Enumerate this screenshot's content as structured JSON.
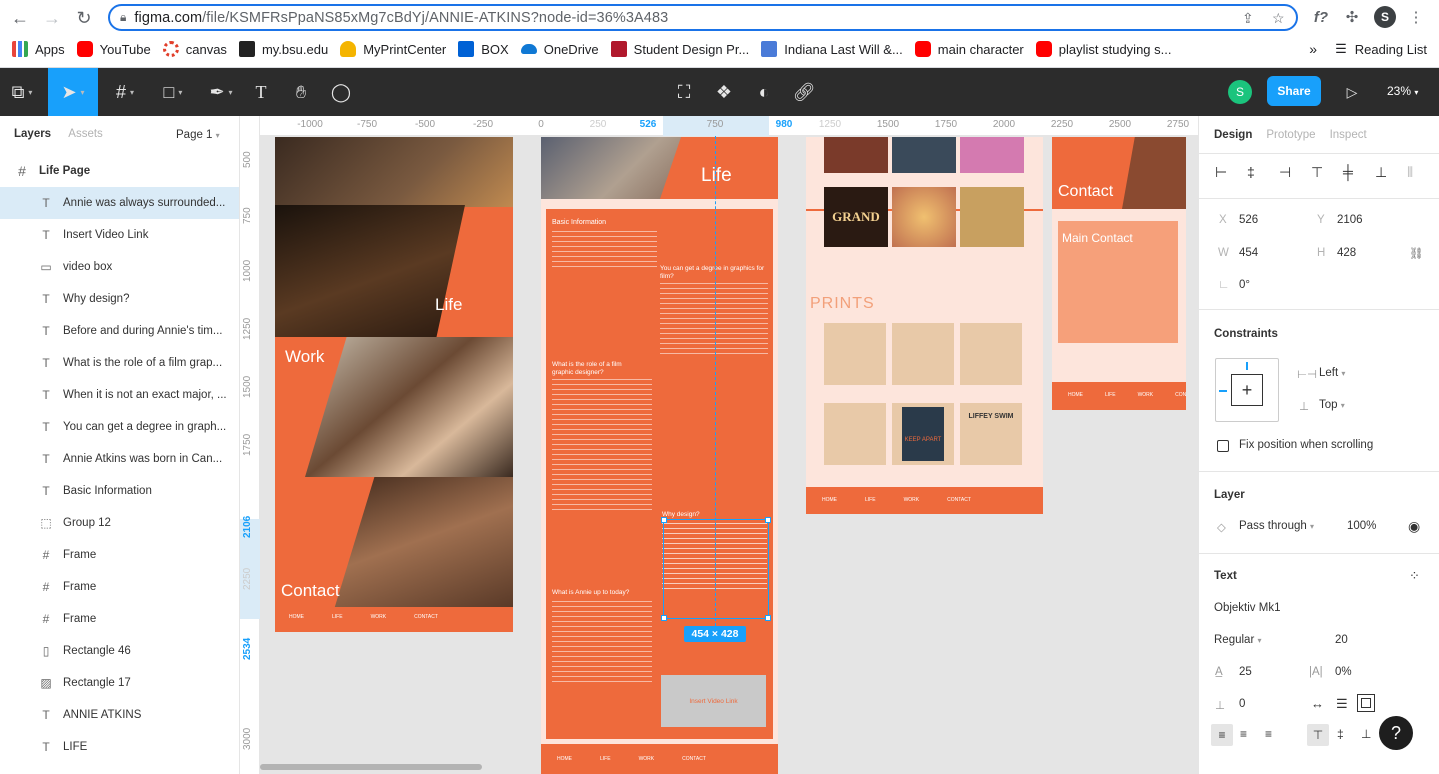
{
  "browser": {
    "url_host": "figma.com",
    "url_path": "/file/KSMFRsPpaNS85xMg7cBdYj/ANNIE-ATKINS?node-id=36%3A483",
    "profile_initial": "S",
    "bookmarks": [
      "Apps",
      "YouTube",
      "canvas",
      "my.bsu.edu",
      "MyPrintCenter",
      "BOX",
      "OneDrive",
      "Student Design Pr...",
      "Indiana Last Will &...",
      "main character",
      "playlist studying s..."
    ],
    "more": "»",
    "reading_list": "Reading List"
  },
  "toolbar": {
    "user_initial": "S",
    "share_label": "Share",
    "zoom": "23%"
  },
  "left_panel": {
    "tab_layers": "Layers",
    "tab_assets": "Assets",
    "page": "Page 1",
    "layers": [
      {
        "name": "Life Page",
        "type": "frame"
      },
      {
        "name": "Annie was always surrounded...",
        "type": "text"
      },
      {
        "name": "Insert Video Link",
        "type": "text"
      },
      {
        "name": "video box",
        "type": "rect"
      },
      {
        "name": "Why design?",
        "type": "text"
      },
      {
        "name": "Before and during Annie's tim...",
        "type": "text"
      },
      {
        "name": "What is the role of a film grap...",
        "type": "text"
      },
      {
        "name": "When it is not an exact major, ...",
        "type": "text"
      },
      {
        "name": "You can get a degree in graph...",
        "type": "text"
      },
      {
        "name": "Annie Atkins was born in Can...",
        "type": "text"
      },
      {
        "name": "Basic Information",
        "type": "text"
      },
      {
        "name": "Group 12",
        "type": "group"
      },
      {
        "name": "Frame",
        "type": "frame"
      },
      {
        "name": "Frame",
        "type": "frame"
      },
      {
        "name": "Frame",
        "type": "frame"
      },
      {
        "name": "Rectangle 46",
        "type": "line"
      },
      {
        "name": "Rectangle 17",
        "type": "image"
      },
      {
        "name": "ANNIE ATKINS",
        "type": "text"
      },
      {
        "name": "LIFE",
        "type": "text"
      }
    ]
  },
  "ruler": {
    "ticks": [
      "-1000",
      "-750",
      "-500",
      "-250",
      "0",
      "250",
      "526",
      "750",
      "980",
      "1250",
      "1500",
      "1750",
      "2000",
      "2250",
      "2500",
      "2750"
    ],
    "vticks": [
      "500",
      "750",
      "1000",
      "1250",
      "1500",
      "1750",
      "2106",
      "2250",
      "2534",
      "3000"
    ]
  },
  "canvas": {
    "frame1": {
      "life": "Life",
      "work": "Work",
      "contact": "Contact",
      "nav": [
        "HOME",
        "LIFE",
        "WORK",
        "CONTACT"
      ]
    },
    "frame2": {
      "life": "Life",
      "basic_info": "Basic Information",
      "degree": "You can get a degree in graphics for film?",
      "role": "What is the role of a film graphic designer?",
      "why": "Why design?",
      "up_to": "What is Annie up to today?",
      "video": "Insert Video Link",
      "nav": [
        "HOME",
        "LIFE",
        "WORK",
        "CONTACT"
      ]
    },
    "frame3": {
      "grand": "GRAND",
      "prints": "PRINTS",
      "keep_apart": "KEEP APART",
      "liffey": "LIFFEY SWIM",
      "nav": [
        "HOME",
        "LIFE",
        "WORK",
        "CONTACT"
      ]
    },
    "frame4": {
      "contact": "Contact",
      "main_contact": "Main Contact",
      "nav": [
        "HOME",
        "LIFE",
        "WORK",
        "CONTA"
      ]
    },
    "selection_size": "454 × 428"
  },
  "right_panel": {
    "tabs": [
      "Design",
      "Prototype",
      "Inspect"
    ],
    "x": "526",
    "y": "2106",
    "w": "454",
    "h": "428",
    "rotation": "0°",
    "constraints_title": "Constraints",
    "constraint_h": "Left",
    "constraint_v": "Top",
    "fix_position": "Fix position when scrolling",
    "layer_title": "Layer",
    "blend": "Pass through",
    "opacity": "100%",
    "text_title": "Text",
    "font": "Objektiv Mk1",
    "weight": "Regular",
    "size": "20",
    "line_height": "25",
    "letter_spacing": "0%",
    "paragraph_spacing": "0"
  }
}
